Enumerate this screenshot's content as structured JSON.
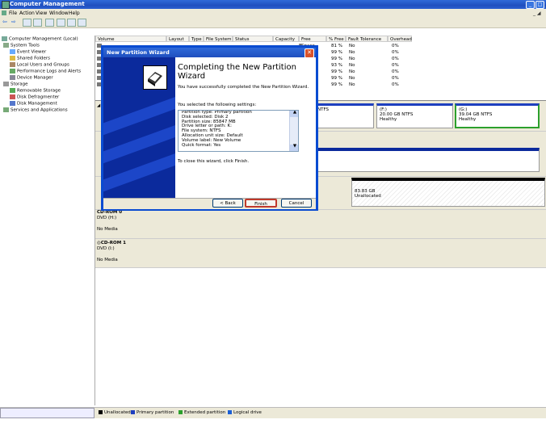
{
  "window": {
    "title": "Computer Management"
  },
  "menu": [
    "File",
    "Action",
    "View",
    "Window",
    "Help"
  ],
  "tree": [
    "Computer Management (Local)",
    "System Tools",
    "Event Viewer",
    "Shared Folders",
    "Local Users and Groups",
    "Performance Logs and Alerts",
    "Device Manager",
    "Storage",
    "Removable Storage",
    "Disk Defragmenter",
    "Disk Management",
    "Services and Applications"
  ],
  "volumes": {
    "headers": [
      "Volume",
      "Layout",
      "Type",
      "File System",
      "Status",
      "Capacity",
      "Free Space",
      "% Free",
      "Fault Tolerance",
      "Overhead"
    ],
    "rows": [
      [
        "B",
        "81 %",
        "No",
        "0%"
      ],
      [
        "B",
        "99 %",
        "No",
        "0%"
      ],
      [
        "B",
        "99 %",
        "No",
        "0%"
      ],
      [
        "B",
        "93 %",
        "No",
        "0%"
      ],
      [
        "B",
        "99 %",
        "No",
        "0%"
      ],
      [
        "GB",
        "99 %",
        "No",
        "0%"
      ],
      [
        "GB",
        "99 %",
        "No",
        "0%"
      ]
    ]
  },
  "graph": {
    "row1": {
      "left_label": "NTFS",
      "p1": {
        "name": "(F:)",
        "size": "20.00 GB NTFS",
        "status": "Healthy"
      },
      "p2": {
        "name": "(G:)",
        "size": "39.04 GB NTFS",
        "status": "Healthy"
      }
    },
    "row3": {
      "unalloc_size": "83.83 GB",
      "unalloc_label": "Unallocated"
    },
    "dvd1": {
      "title": "CD-ROM 0",
      "drive": "DVD (H:)",
      "media": "No Media"
    },
    "dvd2": {
      "title": "CD-ROM 1",
      "drive": "DVD (I:)",
      "media": "No Media"
    }
  },
  "legend": [
    "Unallocated",
    "Primary partition",
    "Extended partition",
    "Logical drive"
  ],
  "colors": {
    "unallocated": "#000000",
    "primary": "#1e3fbf",
    "extended": "#2ca02c",
    "logical": "#1a5fd6"
  },
  "dialog": {
    "title": "New Partition Wizard",
    "heading": "Completing the New Partition Wizard",
    "success": "You have successfully completed the New Partition Wizard.",
    "selected": "You selected the following settings:",
    "settings": [
      "Partition type: Primary partition",
      "Disk selected: Disk 2",
      "Partition size: 85847 MB",
      "Drive letter or path: K:",
      "File system: NTFS",
      "Allocation unit size: Default",
      "Volume label: New Volume",
      "Quick format: Yes"
    ],
    "close_text": "To close this wizard, click Finish.",
    "back": "< Back",
    "finish": "Finish",
    "cancel": "Cancel"
  }
}
